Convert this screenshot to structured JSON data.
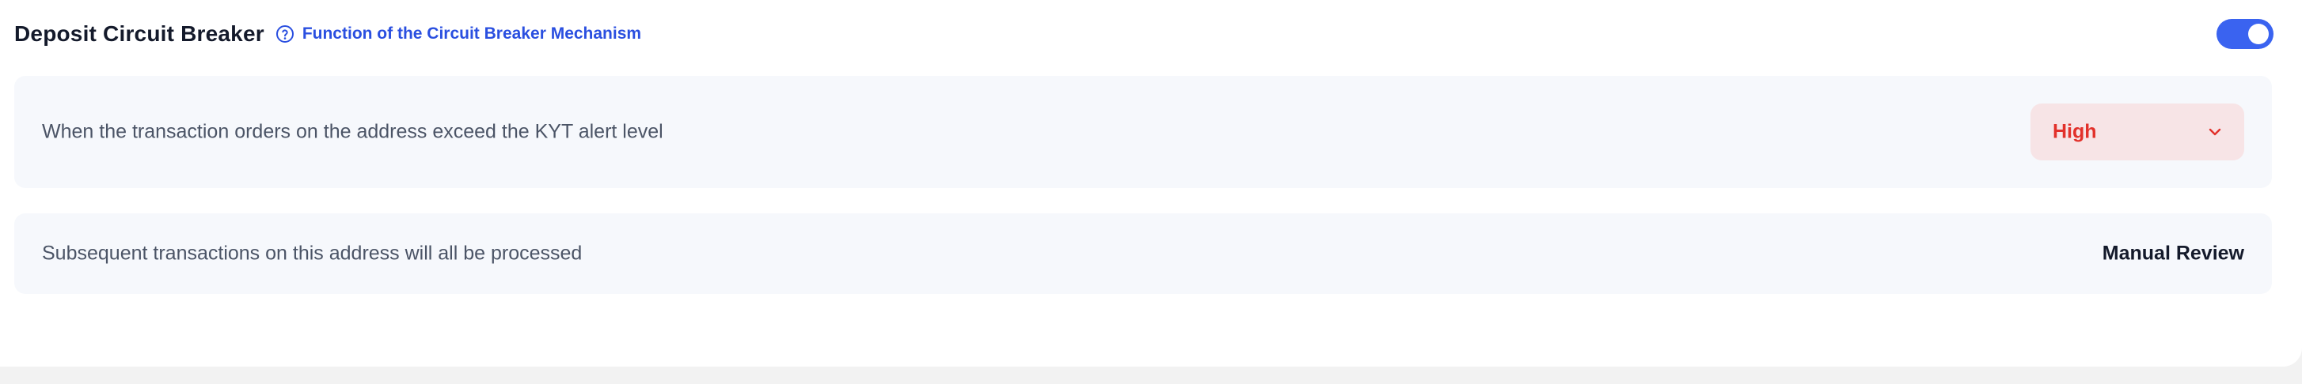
{
  "header": {
    "title": "Deposit Circuit Breaker",
    "help_link_label": "Function of the Circuit Breaker Mechanism",
    "help_icon": "question-circle-icon",
    "toggle_enabled": true
  },
  "rules": [
    {
      "description": "When the transaction orders on the address exceed the KYT alert level",
      "selected_level": "High",
      "dropdown_icon": "chevron-down-icon"
    },
    {
      "description": "Subsequent transactions on this address will all be processed",
      "action": "Manual Review"
    }
  ],
  "colors": {
    "accent_blue": "#3a63f0",
    "link_blue": "#2a4fe0",
    "danger_red": "#e2312b",
    "danger_bg": "#f7e4e6",
    "row_bg": "#f6f8fc"
  }
}
